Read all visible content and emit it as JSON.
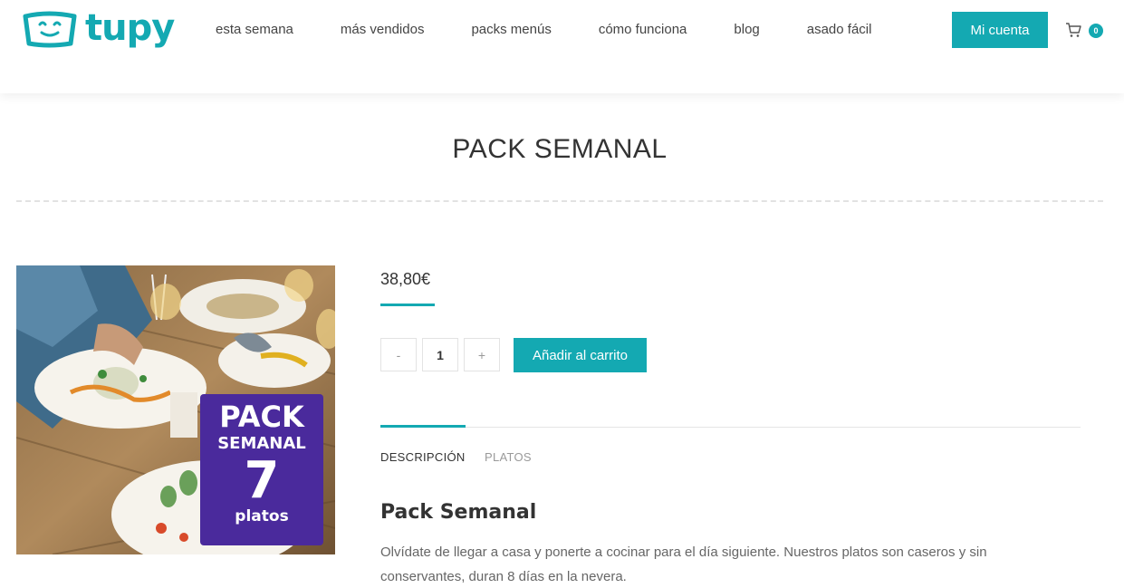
{
  "brand": {
    "name": "tupy",
    "accent": "#14a9b2",
    "badge_color": "#4a2a9c"
  },
  "nav": {
    "items": [
      "esta semana",
      "más vendidos",
      "packs menús",
      "cómo funciona",
      "blog",
      "asado fácil"
    ],
    "account_label": "Mi cuenta",
    "cart_icon": "cart-icon",
    "cart_count": "0"
  },
  "page": {
    "title": "PACK SEMANAL"
  },
  "product": {
    "image_badge": {
      "line1": "PACK",
      "line2": "SEMANAL",
      "line3": "7",
      "line4": "platos"
    },
    "price": "38,80€",
    "qty_minus": "-",
    "qty_value": "1",
    "qty_plus": "+",
    "add_to_cart": "Añadir al carrito"
  },
  "tabs": [
    {
      "label": "DESCRIPCIÓN",
      "active": true
    },
    {
      "label": "PLATOS",
      "active": false
    }
  ],
  "description": {
    "title": "Pack Semanal",
    "text": "Olvídate de llegar a casa y ponerte a cocinar para el día siguiente. Nuestros platos son caseros y sin conservantes, duran 8 días en la nevera."
  }
}
